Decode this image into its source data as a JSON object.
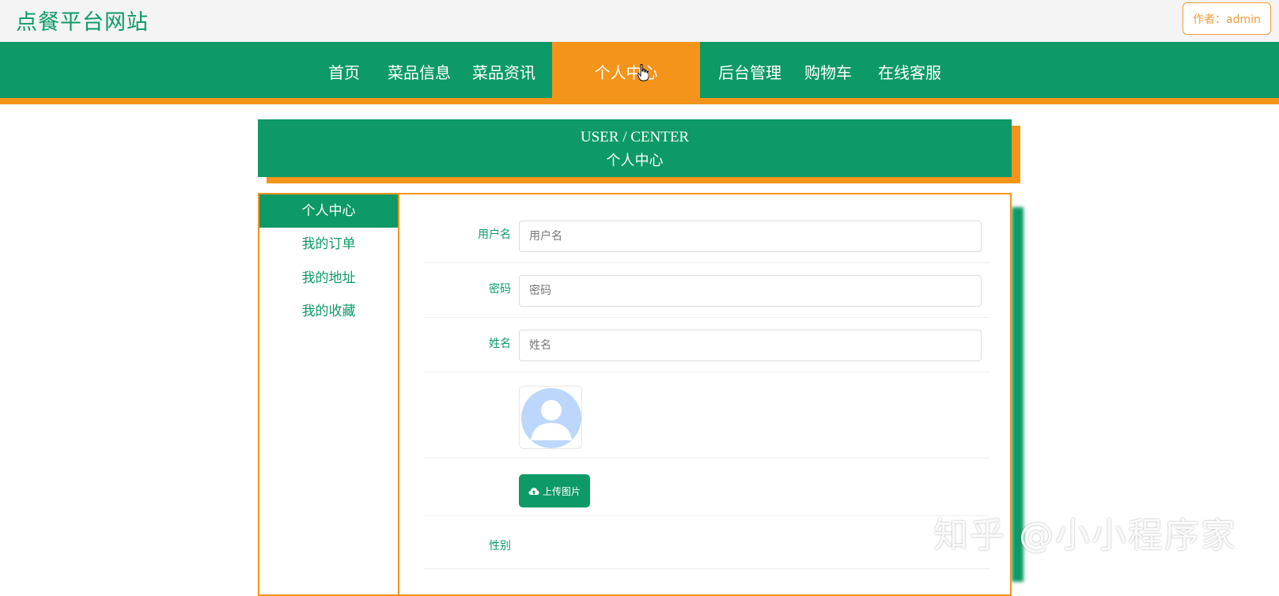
{
  "header": {
    "site_title": "点餐平台网站",
    "author_badge": "作者：admin"
  },
  "nav": {
    "items": [
      {
        "label": "首页"
      },
      {
        "label": "菜品信息"
      },
      {
        "label": "菜品资讯"
      },
      {
        "label": "个人中心",
        "active": true
      },
      {
        "label": "后台管理"
      },
      {
        "label": "购物车"
      },
      {
        "label": "在线客服"
      }
    ]
  },
  "banner": {
    "en": "USER / CENTER",
    "zh": "个人中心"
  },
  "sidebar": {
    "items": [
      {
        "label": "个人中心",
        "active": true
      },
      {
        "label": "我的订单"
      },
      {
        "label": "我的地址"
      },
      {
        "label": "我的收藏"
      }
    ]
  },
  "form": {
    "username": {
      "label": "用户名",
      "placeholder": "用户名"
    },
    "password": {
      "label": "密码",
      "placeholder": "密码"
    },
    "name": {
      "label": "姓名",
      "placeholder": "姓名"
    },
    "upload_label": "上传图片",
    "gender_label": "性别"
  },
  "icons": {
    "avatar": "avatar-placeholder-icon",
    "upload": "cloud-upload-icon",
    "cursor": "hand-pointer-icon"
  },
  "colors": {
    "primary": "#0d9a67",
    "accent": "#f5941b",
    "avatar": "#bcd7fb"
  },
  "watermark": "知乎 @小小程序家"
}
